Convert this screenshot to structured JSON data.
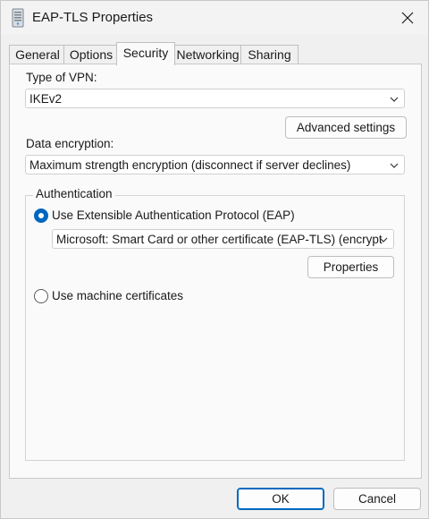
{
  "window": {
    "title": "EAP-TLS Properties"
  },
  "tabs": [
    {
      "label": "General"
    },
    {
      "label": "Options"
    },
    {
      "label": "Security"
    },
    {
      "label": "Networking"
    },
    {
      "label": "Sharing"
    }
  ],
  "active_tab": "Security",
  "vpn_type": {
    "label": "Type of VPN:",
    "value": "IKEv2"
  },
  "advanced_settings_label": "Advanced settings",
  "encryption": {
    "label": "Data encryption:",
    "value": "Maximum strength encryption (disconnect if server declines)"
  },
  "authentication": {
    "legend": "Authentication",
    "eap_option": {
      "label": "Use Extensible Authentication Protocol (EAP)",
      "selected": true
    },
    "eap_method": "Microsoft: Smart Card or other certificate (EAP-TLS) (encrypt",
    "properties_label": "Properties",
    "machine_cert_option": {
      "label": "Use machine certificates",
      "selected": false
    }
  },
  "footer": {
    "ok_label": "OK",
    "cancel_label": "Cancel"
  },
  "colors": {
    "accent": "#0067c0",
    "panel": "#fafafa",
    "window": "#f0f0f0"
  }
}
